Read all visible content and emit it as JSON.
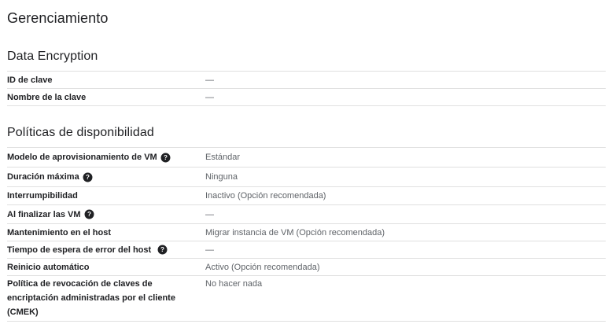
{
  "page": {
    "title": "Gerenciamiento"
  },
  "encryption": {
    "title": "Data Encryption",
    "rows": [
      {
        "key": "ID de clave",
        "value": "—"
      },
      {
        "key": "Nombre de la clave",
        "value": "—"
      }
    ]
  },
  "availability": {
    "title": "Políticas de disponibilidad",
    "rows": [
      {
        "key": "Modelo de aprovisionamiento de VM",
        "value": "Estándar",
        "help_icon": "help-circle-icon"
      },
      {
        "key": "Duración máxima",
        "value": "Ninguna",
        "help_icon": "help-circle-icon"
      },
      {
        "key": "Interrumpibilidad",
        "value": "Inactivo (Opción recomendada)"
      },
      {
        "key": "Al finalizar las VM",
        "value": "—",
        "help_icon": "help-circle-icon"
      },
      {
        "key": "Mantenimiento en el host",
        "value": "Migrar instancia de VM (Opción recomendada)"
      },
      {
        "key": "Tiempo de espera de error del host",
        "value": "—",
        "help_icon": "help-circle-icon"
      },
      {
        "key": "Reinicio automático",
        "value": "Activo (Opción recomendada)"
      },
      {
        "key": "Política de revocación de claves de encriptación administradas por el cliente (CMEK)",
        "value": "No hacer nada"
      }
    ]
  }
}
